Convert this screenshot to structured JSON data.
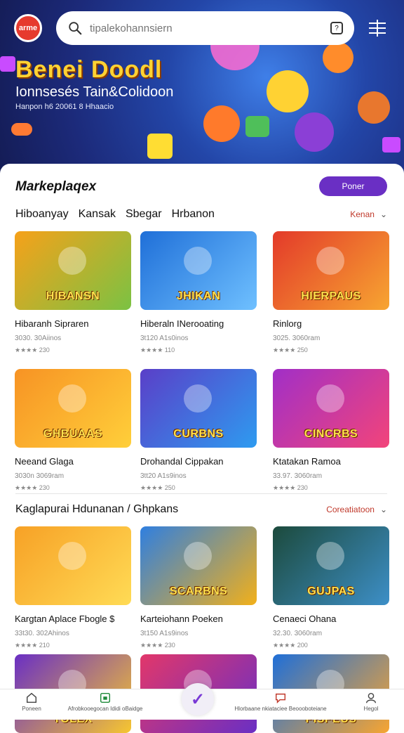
{
  "header": {
    "logo_text": "arme",
    "search_placeholder": "tipalekohannsiern",
    "mic_label": "?"
  },
  "hero": {
    "title": "Benei Doodl",
    "subtitle": "Ionnsesés Tain&Colidoon",
    "small": "Hanpon h6 20061 8 Hhaacio"
  },
  "marketplace": {
    "title": "Markeplaqex",
    "button": "Poner"
  },
  "section1": {
    "tabs": [
      "Hiboanyay",
      "Kansak",
      "Sbegar",
      "Hrbanon"
    ],
    "link": "Kenan",
    "cards": [
      {
        "thumb_text": "HIBANSN",
        "name": "Hibaranh Sipraren",
        "price": "3030. 30Aiinos",
        "rating": "★★★★ 230",
        "colors": [
          "#f6a11a",
          "#7bc243"
        ]
      },
      {
        "thumb_text": "JHIKAN",
        "name": "Hiberaln INerooating",
        "price": "3t120 A1s0inos",
        "rating": "★★★★ 110",
        "colors": [
          "#1f6fd8",
          "#6fc0ff"
        ]
      },
      {
        "thumb_text": "HIERPAUS",
        "name": "Rinlorg",
        "price": "3025. 3060ram",
        "rating": "★★★★ 250",
        "colors": [
          "#e33a2a",
          "#f7a531"
        ]
      },
      {
        "thumb_text": "GHBUAAS",
        "name": "Neeand Glaga",
        "price": "3030n 3069ram",
        "rating": "★★★★ 230",
        "colors": [
          "#f79324",
          "#ffcf3a"
        ]
      },
      {
        "thumb_text": "CURBNS",
        "name": "Drohandal Cippakan",
        "price": "3tt20 A1s9inos",
        "rating": "★★★★ 250",
        "colors": [
          "#5a3fc8",
          "#2e9bf0"
        ]
      },
      {
        "thumb_text": "CINCRBS",
        "name": "Ktatakan Ramoa",
        "price": "33.97. 3060ram",
        "rating": "★★★★ 230",
        "colors": [
          "#a12fc7",
          "#f2447a"
        ]
      }
    ]
  },
  "section2": {
    "title": "Kaglapurai Hdunanan / Ghpkans",
    "link": "Coreatiatoon",
    "cards": [
      {
        "thumb_text": "",
        "name": "Kargtan Aplace Fbogle $",
        "price": "33t30. 302Ahinos",
        "rating": "★★★★ 210",
        "colors": [
          "#f7a126",
          "#ffdb55"
        ]
      },
      {
        "thumb_text": "SCARBNS",
        "name": "Karteiohann Poeken",
        "price": "3t150 A1s9inos",
        "rating": "★★★★ 230",
        "colors": [
          "#2f7fe0",
          "#f2b01a"
        ]
      },
      {
        "thumb_text": "GUJPAS",
        "name": "Cenaeci Ohana",
        "price": "32.30. 3060ram",
        "rating": "★★★★ 200",
        "colors": [
          "#1c4a3c",
          "#3d8fc7"
        ]
      }
    ],
    "bottom_cards": [
      {
        "thumb_text": "TOLEX",
        "colors": [
          "#6a2fc4",
          "#f6c630"
        ]
      },
      {
        "thumb_text": "",
        "colors": [
          "#e2376a",
          "#6a2fc4"
        ]
      },
      {
        "thumb_text": "PISPEUS",
        "colors": [
          "#1f6fd8",
          "#f7a531"
        ]
      }
    ]
  },
  "nav": {
    "items": [
      {
        "label": "Poneen",
        "icon": "home-icon"
      },
      {
        "label": "Afrobkooegocan Ididi oBaidge",
        "icon": "calendar-icon"
      },
      {
        "label": "Hlorbaane nkiataciee Beoooboteiane",
        "icon": "chat-icon"
      },
      {
        "label": "Hegol",
        "icon": "user-icon"
      }
    ]
  }
}
